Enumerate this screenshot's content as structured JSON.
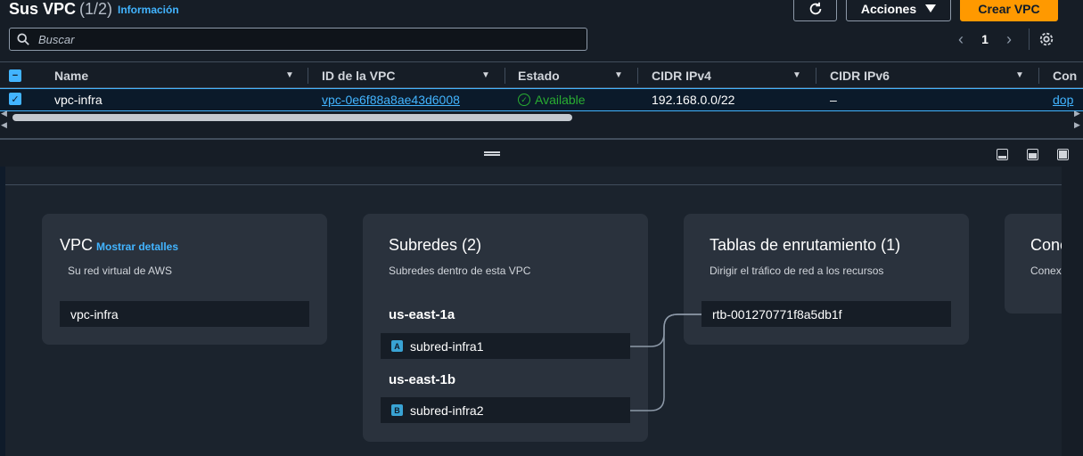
{
  "header": {
    "title": "Sus VPC",
    "count": "(1/2)",
    "info_link": "Información",
    "actions_label": "Acciones",
    "create_label": "Crear VPC"
  },
  "search": {
    "placeholder": "Buscar",
    "value": ""
  },
  "pagination": {
    "current_page": "1"
  },
  "table": {
    "columns": [
      "Name",
      "ID de la VPC",
      "Estado",
      "CIDR IPv4",
      "CIDR IPv6",
      "Con"
    ],
    "rows": [
      {
        "selected": true,
        "name": "vpc-infra",
        "vpc_id": "vpc-0e6f88a8ae43d6008",
        "status": "Available",
        "cidr_ipv4": "192.168.0.0/22",
        "cidr_ipv6": "–",
        "extra": "dop"
      }
    ]
  },
  "resource_map": {
    "vpc": {
      "title": "VPC",
      "details_link": "Mostrar detalles",
      "description": "Su red virtual de AWS",
      "value": "vpc-infra"
    },
    "subnets": {
      "title": "Subredes (2)",
      "description": "Subredes dentro de esta VPC",
      "zones": [
        {
          "name": "us-east-1a",
          "badge": "A",
          "subnet": "subred-infra1"
        },
        {
          "name": "us-east-1b",
          "badge": "B",
          "subnet": "subred-infra2"
        }
      ]
    },
    "route_tables": {
      "title": "Tablas de enrutamiento (1)",
      "description": "Dirigir el tráfico de red a los recursos",
      "value": "rtb-001270771f8a5db1f"
    },
    "connections": {
      "title": "Cone",
      "description": "Conexi"
    }
  },
  "colors": {
    "accent": "#42b4ff",
    "primary_button": "#ff9900",
    "status_ok": "#29ad32",
    "card_bg": "#2a323d"
  },
  "icons": {
    "refresh": "refresh-icon",
    "actions_caret": "caret-down-icon",
    "search": "search-icon",
    "settings": "gear-icon",
    "status": "check-circle-icon"
  }
}
